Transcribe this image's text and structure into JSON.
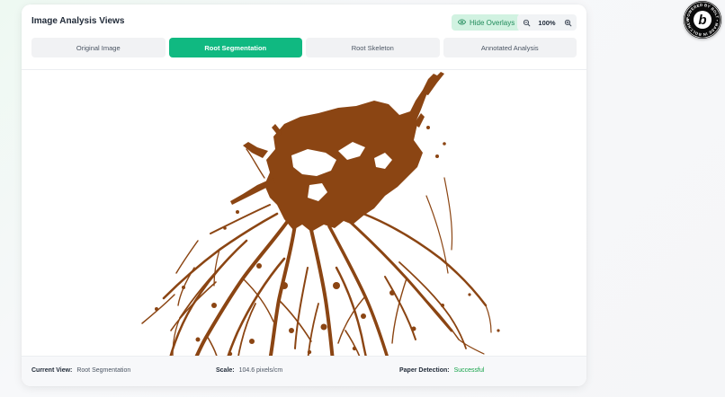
{
  "header": {
    "title": "Image Analysis Views",
    "overlay_button": "Hide Overlays",
    "zoom_level": "100%"
  },
  "tabs": [
    {
      "label": "Original Image",
      "active": false
    },
    {
      "label": "Root Segmentation",
      "active": true
    },
    {
      "label": "Root Skeleton",
      "active": false
    },
    {
      "label": "Annotated Analysis",
      "active": false
    }
  ],
  "footer": {
    "current_view_label": "Current View:",
    "current_view_value": "Root Segmentation",
    "scale_label": "Scale:",
    "scale_value": "104.6 pixels/cm",
    "paper_label": "Paper Detection:",
    "paper_value": "Successful"
  },
  "badge": {
    "letter": "b",
    "ring_text": "POWERED BY BOLT • MADE IN BOLT.NEW •"
  },
  "colors": {
    "accent": "#10b981",
    "root": "#8b4513",
    "success": "#16a34a"
  },
  "icons": {
    "overlay": "eye-icon",
    "zoom_out": "zoom-out-icon",
    "zoom_in": "zoom-in-icon"
  }
}
